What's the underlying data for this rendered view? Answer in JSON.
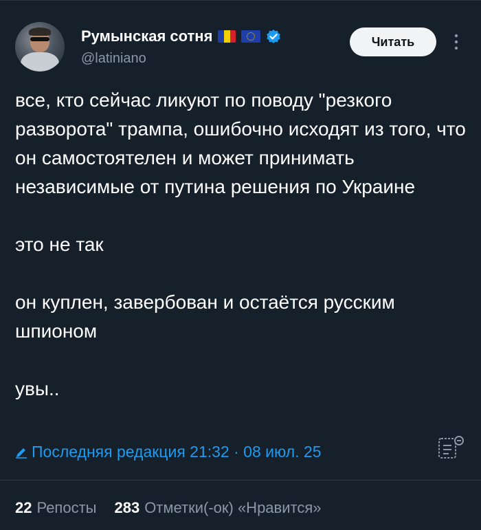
{
  "author": {
    "display_name": "Румынская сотня",
    "handle": "@latiniano",
    "flags": [
      "romania-flag",
      "eu-flag"
    ],
    "verified_icon": "verified-badge-icon"
  },
  "header": {
    "follow_label": "Читать",
    "more_icon": "more-vertical-icon"
  },
  "tweet": {
    "paragraphs": [
      "все, кто сейчас ликуют по поводу \"резкого разворота\" трампа, ошибочно исходят из того, что он самостоятелен и может принимать независимые от путина решения по Украине",
      "это не так",
      "он куплен, завербован и остаётся русским шпионом",
      "увы.."
    ],
    "edit_note": "Последняя редакция 21:32 · 08 июл. 25"
  },
  "stats": {
    "reposts_count": "22",
    "reposts_label": "Репосты",
    "likes_count": "283",
    "likes_label": "Отметки(-ок) «Нравится»"
  },
  "colors": {
    "background": "#15202b",
    "accent": "#1d9bf0",
    "secondary_text": "#8b98a5",
    "follow_button_bg": "#f2f4f5"
  }
}
